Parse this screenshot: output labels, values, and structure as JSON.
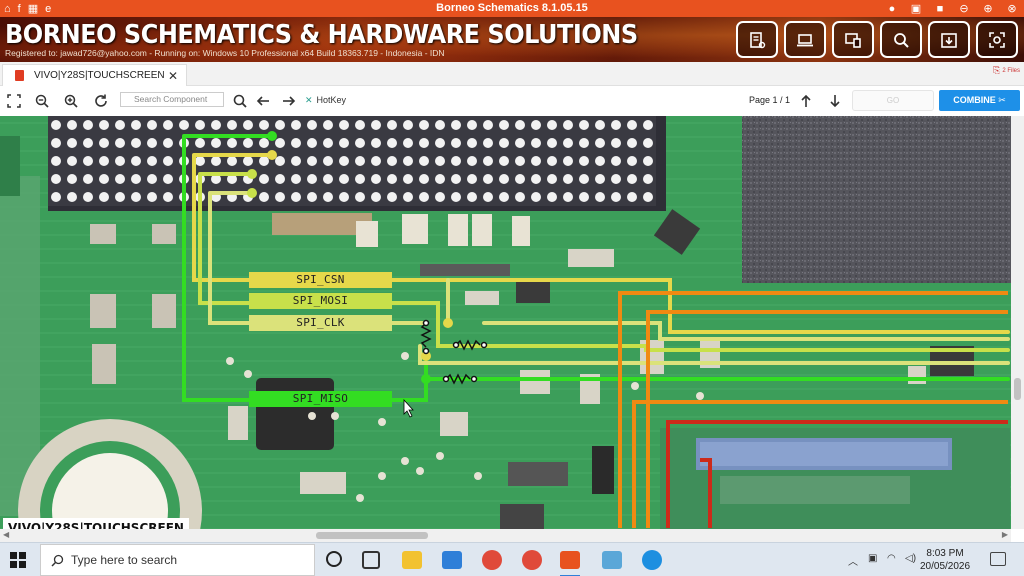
{
  "window": {
    "title": "Borneo Schematics 8.1.05.15",
    "brand": "BORNEO SCHEMATICS & HARDWARE SOLUTIONS",
    "registration": "Registered to: jawad726@yahoo.com - Running on: Windows 10 Professional x64 Build 18363.719 - Indonesia - IDN"
  },
  "tab": {
    "label": "VIVO|Y28S|TOUCHSCREEN",
    "files_badge": "2 Files"
  },
  "toolbar": {
    "search_placeholder": "Search Component",
    "hotkey_label": "HotKey",
    "page_info": "Page 1 / 1",
    "go_placeholder": "GO",
    "combine_label": "COMBINE"
  },
  "board": {
    "nets": [
      "SPI_CSN",
      "SPI_MOSI",
      "SPI_CLK",
      "SPI_MISO"
    ],
    "model_label": "VIVO|Y28S|TOUCHSCREEN"
  },
  "taskbar": {
    "search_placeholder": "Type here to search",
    "time": "8:03 PM",
    "date": "20/05/2026"
  },
  "colors": {
    "titlebar": "#e8521f",
    "board": "#3c9e5a",
    "combine": "#1e90e8",
    "net_green": "#33dd22",
    "net_yellow": "#e6d84a",
    "net_orange": "#f08a12",
    "net_red": "#cc2a1a"
  }
}
